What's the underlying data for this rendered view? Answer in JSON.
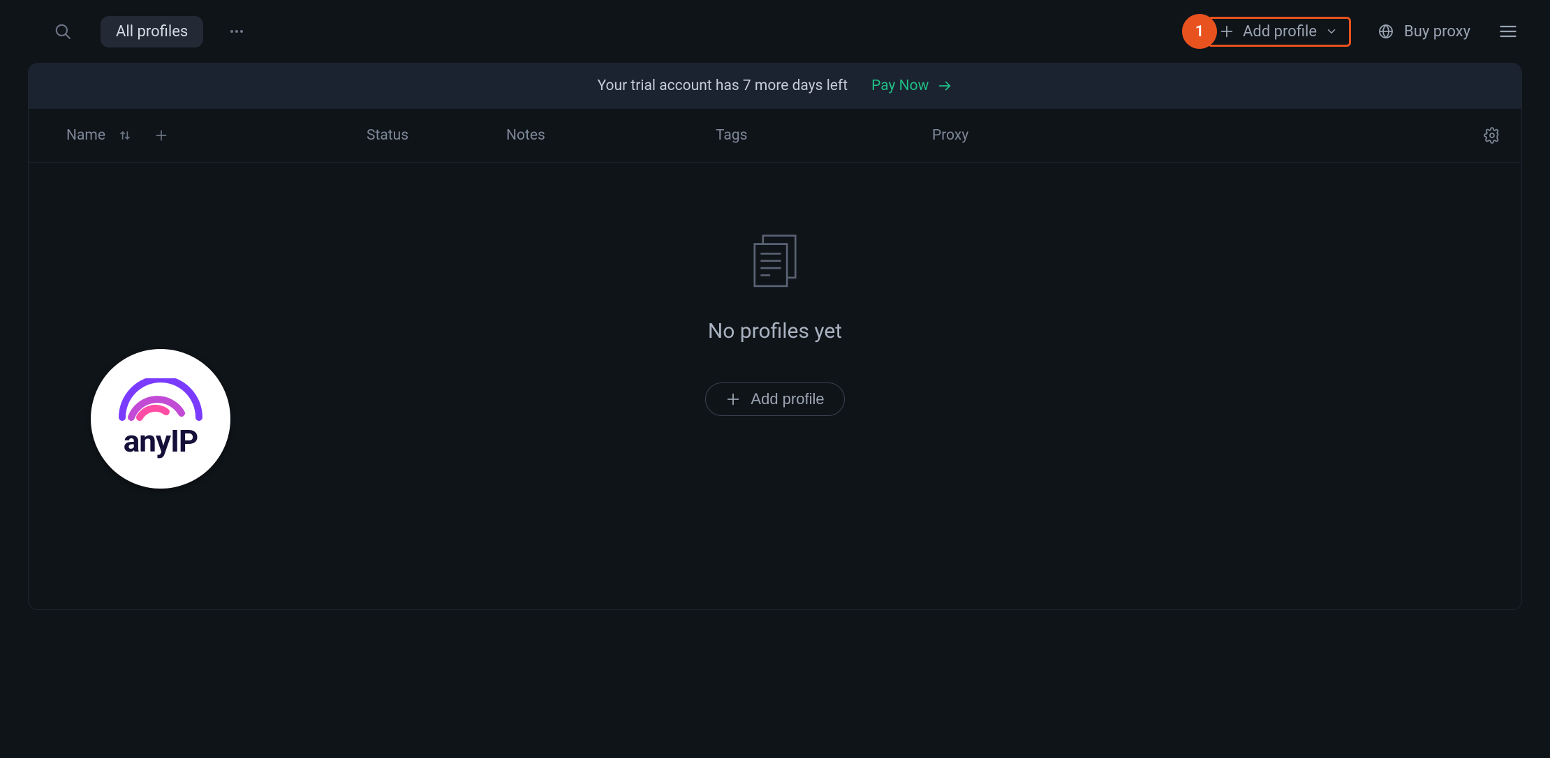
{
  "topbar": {
    "filter_pill": "All profiles",
    "add_profile_label": "Add profile",
    "callout_number": "1",
    "buy_proxy_label": "Buy proxy"
  },
  "banner": {
    "trial_text": "Your trial account has 7 more days left",
    "pay_now_label": "Pay Now"
  },
  "columns": {
    "name": "Name",
    "status": "Status",
    "notes": "Notes",
    "tags": "Tags",
    "proxy": "Proxy"
  },
  "empty": {
    "title": "No profiles yet",
    "add_profile_label": "Add profile"
  },
  "brand": {
    "name": "anyIP"
  },
  "colors": {
    "accent_orange": "#e8521e",
    "accent_green": "#1fbf86"
  }
}
